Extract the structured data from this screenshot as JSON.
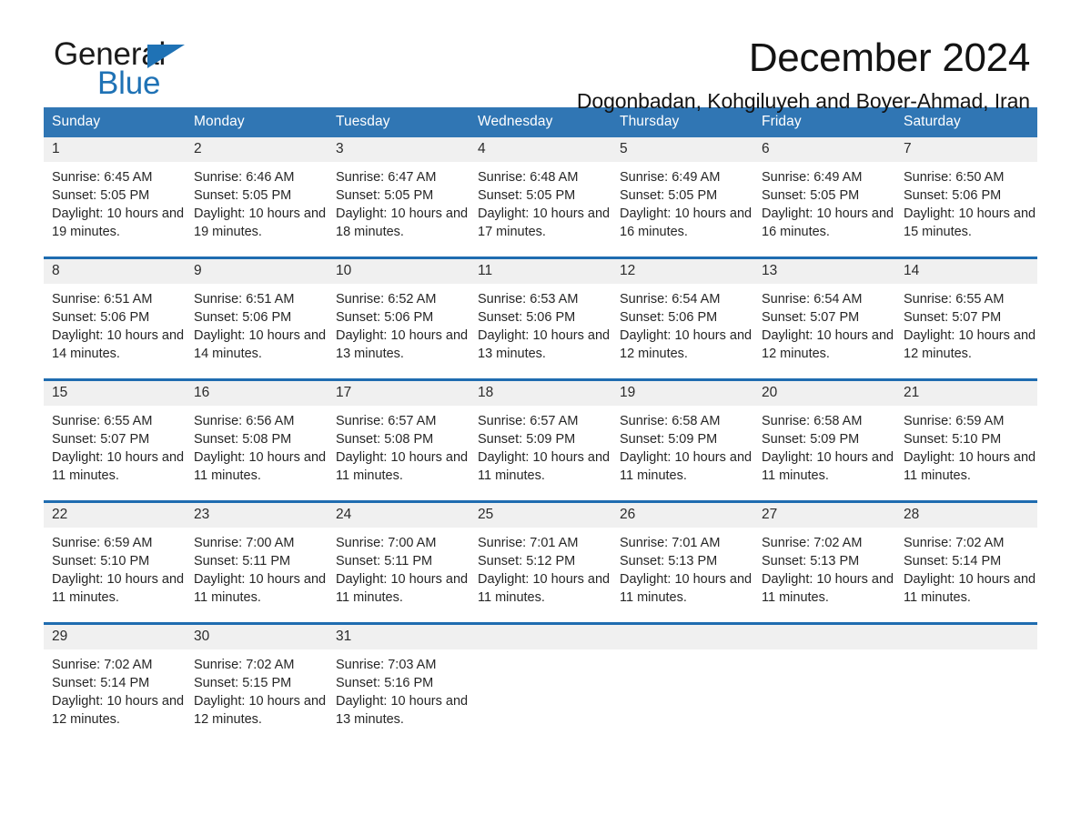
{
  "brand": {
    "name_part1": "General",
    "name_part2": "Blue",
    "triangle_icon": "triangle-icon",
    "accent_color": "#1f72b5"
  },
  "header": {
    "month_title": "December 2024",
    "location": "Dogonbadan, Kohgiluyeh and Boyer-Ahmad, Iran"
  },
  "colors": {
    "header_row_bg": "#3076b4",
    "row_divider": "#1f6cb0",
    "daynum_band_bg": "#f0f0f0",
    "text": "#262626"
  },
  "weekday_headers": [
    "Sunday",
    "Monday",
    "Tuesday",
    "Wednesday",
    "Thursday",
    "Friday",
    "Saturday"
  ],
  "weeks": [
    [
      {
        "day": "1",
        "details": "Sunrise: 6:45 AM\nSunset: 5:05 PM\nDaylight: 10 hours and 19 minutes."
      },
      {
        "day": "2",
        "details": "Sunrise: 6:46 AM\nSunset: 5:05 PM\nDaylight: 10 hours and 19 minutes."
      },
      {
        "day": "3",
        "details": "Sunrise: 6:47 AM\nSunset: 5:05 PM\nDaylight: 10 hours and 18 minutes."
      },
      {
        "day": "4",
        "details": "Sunrise: 6:48 AM\nSunset: 5:05 PM\nDaylight: 10 hours and 17 minutes."
      },
      {
        "day": "5",
        "details": "Sunrise: 6:49 AM\nSunset: 5:05 PM\nDaylight: 10 hours and 16 minutes."
      },
      {
        "day": "6",
        "details": "Sunrise: 6:49 AM\nSunset: 5:05 PM\nDaylight: 10 hours and 16 minutes."
      },
      {
        "day": "7",
        "details": "Sunrise: 6:50 AM\nSunset: 5:06 PM\nDaylight: 10 hours and 15 minutes."
      }
    ],
    [
      {
        "day": "8",
        "details": "Sunrise: 6:51 AM\nSunset: 5:06 PM\nDaylight: 10 hours and 14 minutes."
      },
      {
        "day": "9",
        "details": "Sunrise: 6:51 AM\nSunset: 5:06 PM\nDaylight: 10 hours and 14 minutes."
      },
      {
        "day": "10",
        "details": "Sunrise: 6:52 AM\nSunset: 5:06 PM\nDaylight: 10 hours and 13 minutes."
      },
      {
        "day": "11",
        "details": "Sunrise: 6:53 AM\nSunset: 5:06 PM\nDaylight: 10 hours and 13 minutes."
      },
      {
        "day": "12",
        "details": "Sunrise: 6:54 AM\nSunset: 5:06 PM\nDaylight: 10 hours and 12 minutes."
      },
      {
        "day": "13",
        "details": "Sunrise: 6:54 AM\nSunset: 5:07 PM\nDaylight: 10 hours and 12 minutes."
      },
      {
        "day": "14",
        "details": "Sunrise: 6:55 AM\nSunset: 5:07 PM\nDaylight: 10 hours and 12 minutes."
      }
    ],
    [
      {
        "day": "15",
        "details": "Sunrise: 6:55 AM\nSunset: 5:07 PM\nDaylight: 10 hours and 11 minutes."
      },
      {
        "day": "16",
        "details": "Sunrise: 6:56 AM\nSunset: 5:08 PM\nDaylight: 10 hours and 11 minutes."
      },
      {
        "day": "17",
        "details": "Sunrise: 6:57 AM\nSunset: 5:08 PM\nDaylight: 10 hours and 11 minutes."
      },
      {
        "day": "18",
        "details": "Sunrise: 6:57 AM\nSunset: 5:09 PM\nDaylight: 10 hours and 11 minutes."
      },
      {
        "day": "19",
        "details": "Sunrise: 6:58 AM\nSunset: 5:09 PM\nDaylight: 10 hours and 11 minutes."
      },
      {
        "day": "20",
        "details": "Sunrise: 6:58 AM\nSunset: 5:09 PM\nDaylight: 10 hours and 11 minutes."
      },
      {
        "day": "21",
        "details": "Sunrise: 6:59 AM\nSunset: 5:10 PM\nDaylight: 10 hours and 11 minutes."
      }
    ],
    [
      {
        "day": "22",
        "details": "Sunrise: 6:59 AM\nSunset: 5:10 PM\nDaylight: 10 hours and 11 minutes."
      },
      {
        "day": "23",
        "details": "Sunrise: 7:00 AM\nSunset: 5:11 PM\nDaylight: 10 hours and 11 minutes."
      },
      {
        "day": "24",
        "details": "Sunrise: 7:00 AM\nSunset: 5:11 PM\nDaylight: 10 hours and 11 minutes."
      },
      {
        "day": "25",
        "details": "Sunrise: 7:01 AM\nSunset: 5:12 PM\nDaylight: 10 hours and 11 minutes."
      },
      {
        "day": "26",
        "details": "Sunrise: 7:01 AM\nSunset: 5:13 PM\nDaylight: 10 hours and 11 minutes."
      },
      {
        "day": "27",
        "details": "Sunrise: 7:02 AM\nSunset: 5:13 PM\nDaylight: 10 hours and 11 minutes."
      },
      {
        "day": "28",
        "details": "Sunrise: 7:02 AM\nSunset: 5:14 PM\nDaylight: 10 hours and 11 minutes."
      }
    ],
    [
      {
        "day": "29",
        "details": "Sunrise: 7:02 AM\nSunset: 5:14 PM\nDaylight: 10 hours and 12 minutes."
      },
      {
        "day": "30",
        "details": "Sunrise: 7:02 AM\nSunset: 5:15 PM\nDaylight: 10 hours and 12 minutes."
      },
      {
        "day": "31",
        "details": "Sunrise: 7:03 AM\nSunset: 5:16 PM\nDaylight: 10 hours and 13 minutes."
      },
      {
        "day": "",
        "details": ""
      },
      {
        "day": "",
        "details": ""
      },
      {
        "day": "",
        "details": ""
      },
      {
        "day": "",
        "details": ""
      }
    ]
  ]
}
